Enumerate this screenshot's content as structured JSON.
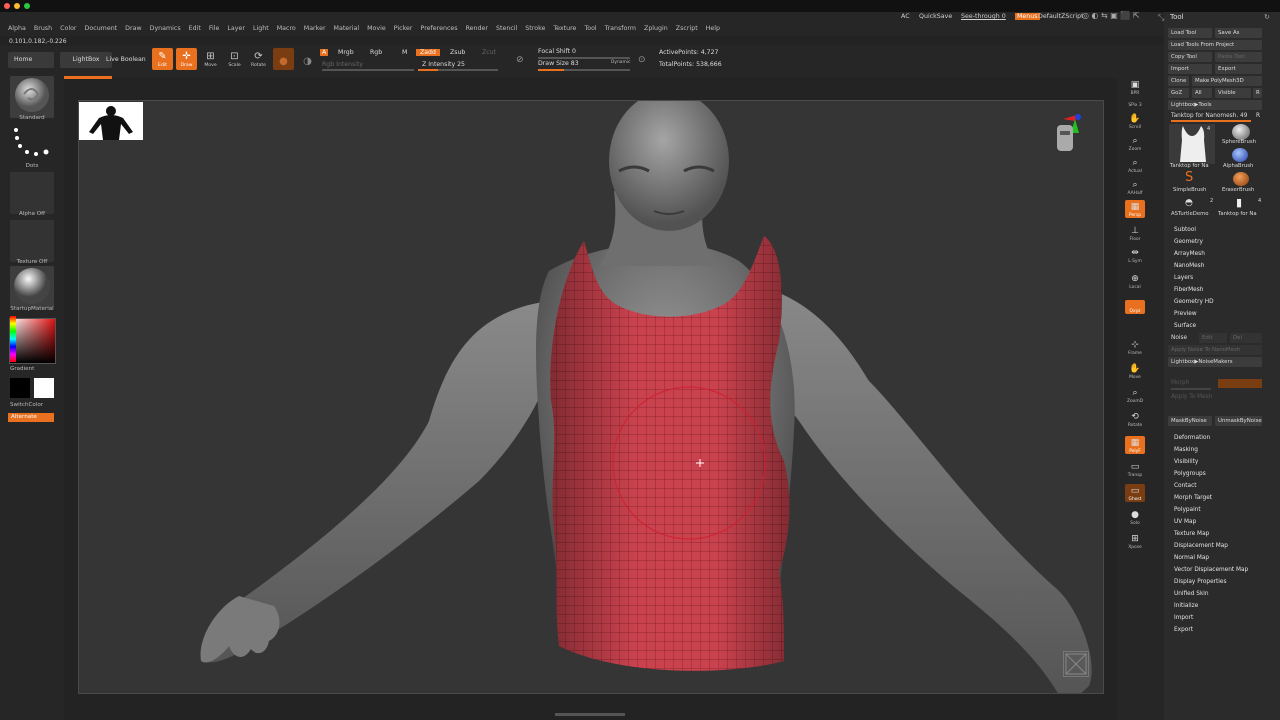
{
  "menubar": {
    "items": [
      "Alpha",
      "Brush",
      "Color",
      "Document",
      "Draw",
      "Dynamics",
      "Edit",
      "File",
      "Layer",
      "Light",
      "Macro",
      "Marker",
      "Material",
      "Movie",
      "Picker",
      "Preferences",
      "Render",
      "Stencil",
      "Stroke",
      "Texture",
      "Tool",
      "Transform",
      "Zplugin",
      "Zscript",
      "Help"
    ],
    "ac": "AC",
    "quicksave": "QuickSave",
    "see_through": "See-through",
    "see_through_value": "0",
    "menus": "Menus",
    "script": "DefaultZScript",
    "coords": "0.101,0.182,-0.226"
  },
  "toolbar": {
    "home_page": "Home Page",
    "lightbox": "LightBox",
    "live_boolean": "Live Boolean",
    "edit": "Edit",
    "draw": "Draw",
    "move": "Move",
    "scale": "Scale",
    "rotate": "Rotate",
    "a": "A",
    "mrgb": "Mrgb",
    "rgb": "Rgb",
    "m": "M",
    "zadd": "Zadd",
    "zsub": "Zsub",
    "zcut": "Zcut",
    "rgb_intensity": "Rgb Intensity",
    "z_intensity": "Z Intensity 25",
    "focal_shift": "Focal Shift 0",
    "draw_size": "Draw Size 83",
    "dynamic": "Dynamic",
    "active_points": "ActivePoints: 4,727",
    "total_points": "TotalPoints: 538,666"
  },
  "left_shelf": {
    "brush_label": "Standard",
    "stroke_label": "Dots",
    "alpha_label": "Alpha Off",
    "texture_label": "Texture Off",
    "material_label": "StartupMaterial",
    "gradient_label": "Gradient",
    "switch_color_label": "SwitchColor",
    "alternate_label": "Alternate"
  },
  "right_shelf": {
    "items": [
      "BPR",
      "SPix 3",
      "Scroll",
      "Zoom",
      "Actual",
      "AAHalf",
      "Persp",
      "Floor",
      "L.Sym",
      "Local",
      "Qxyz",
      "Frame",
      "Move",
      "ZoomD",
      "Rotate",
      "PolyF",
      "Transp",
      "Ghost",
      "Solo",
      "Xpose"
    ]
  },
  "tool_panel": {
    "title": "Tool",
    "load_tool": "Load Tool",
    "save_as": "Save As",
    "load_from_project": "Load Tools From Project",
    "copy_tool": "Copy Tool",
    "paste_tool": "Paste Tool",
    "import": "Import",
    "export": "Export",
    "clone": "Clone",
    "make_polymesh": "Make PolyMesh3D",
    "goz": "GoZ",
    "all": "All",
    "visible": "Visible",
    "r": "R",
    "lightbox_tools": "Lightbox▶Tools",
    "current_tool": "Tanktop for Nanomesh.",
    "current_tool_value": "49",
    "r2": "R",
    "tool_thumbs": [
      "Tanktop for Na",
      "SphereBrush",
      "AlphaBrush",
      "SimpleBrush",
      "EraserBrush",
      "ASTurtleDemo",
      "Tanktop for Na"
    ],
    "thumb_counts": [
      "4",
      "2",
      "4"
    ],
    "subpalettes_top": [
      "Subtool",
      "Geometry",
      "ArrayMesh",
      "NanoMesh",
      "Layers",
      "FiberMesh",
      "Geometry HD",
      "Preview",
      "Surface"
    ],
    "noise": "Noise",
    "noise_edit": "Edit",
    "noise_del": "Del",
    "apply_noise_to_nanomesh": "Apply Noise To NanoMesh",
    "lightbox_noisemakers": "Lightbox▶NoiseMakers",
    "morph": "Morph",
    "apply_to_mesh": "Apply To Mesh",
    "mask_by_noise": "MaskByNoise",
    "unmask_by_noise": "UnmaskByNoise",
    "subpalettes_bottom": [
      "Deformation",
      "Masking",
      "Visibility",
      "Polygroups",
      "Contact",
      "Morph Target",
      "Polypaint",
      "UV Map",
      "Texture Map",
      "Displacement Map",
      "Normal Map",
      "Vector Displacement Map",
      "Display Properties",
      "Unified Skin",
      "Initialize",
      "Import",
      "Export"
    ]
  },
  "colors": {
    "accent": "#e8701e",
    "bg": "#232323",
    "viewport": "#353535",
    "panel": "#2b2b2b",
    "tanktop": "#c9424e"
  }
}
